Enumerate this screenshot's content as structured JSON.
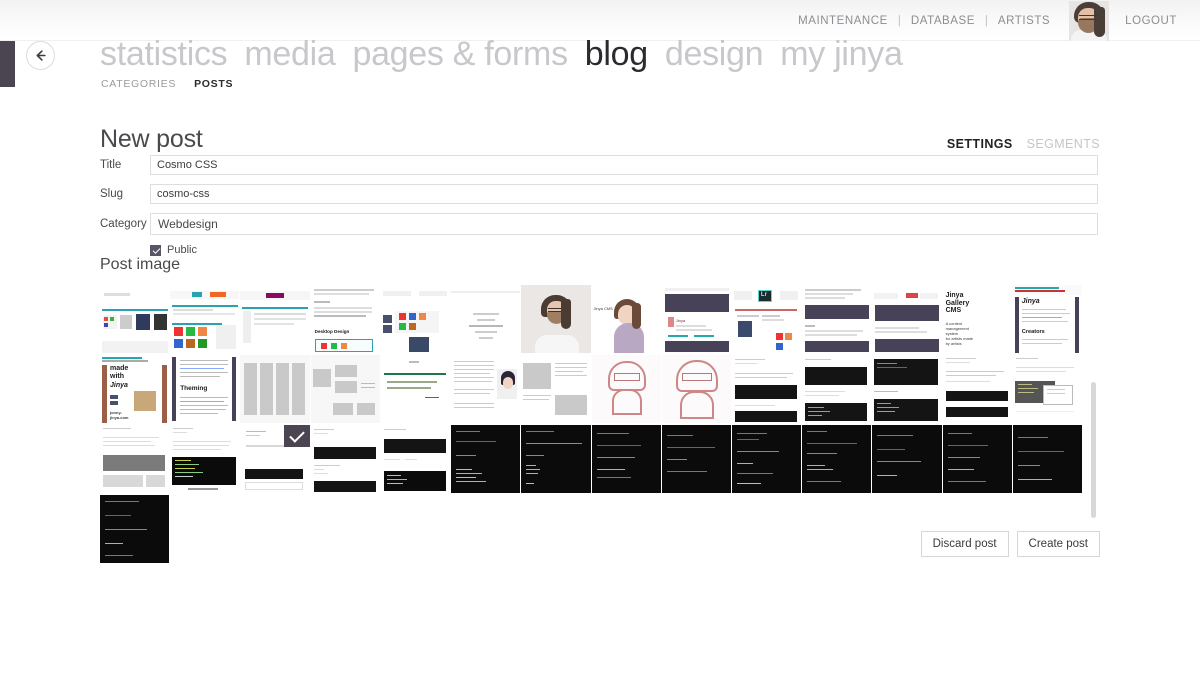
{
  "topbar": {
    "links": [
      {
        "label": "MAINTENANCE",
        "name": "maintenance"
      },
      {
        "label": "DATABASE",
        "name": "database"
      },
      {
        "label": "ARTISTS",
        "name": "artists"
      }
    ],
    "separator": "|",
    "logout_label": "LOGOUT",
    "avatar_name": "user-avatar"
  },
  "nav": {
    "back_icon": "arrow-left-icon",
    "items": [
      {
        "label": "statistics",
        "active": false
      },
      {
        "label": "media",
        "active": false
      },
      {
        "label": "pages & forms",
        "active": false
      },
      {
        "label": "blog",
        "active": true
      },
      {
        "label": "design",
        "active": false
      },
      {
        "label": "my jinya",
        "active": false
      }
    ],
    "sub_items": [
      {
        "label": "CATEGORIES",
        "active": false
      },
      {
        "label": "POSTS",
        "active": true
      }
    ]
  },
  "page": {
    "title": "New post"
  },
  "tabs": [
    {
      "label": "SETTINGS",
      "active": true
    },
    {
      "label": "SEGMENTS",
      "active": false
    }
  ],
  "form": {
    "title": {
      "label": "Title",
      "value": "Cosmo CSS",
      "placeholder": "Title"
    },
    "slug": {
      "label": "Slug",
      "value": "cosmo-css",
      "placeholder": "Slug"
    },
    "category": {
      "label": "Category",
      "value": "Webdesign",
      "arrow_icon": "chevron-down-icon"
    },
    "public": {
      "label": "Public",
      "checked": true
    }
  },
  "post_image": {
    "section_label": "Post image",
    "selected_index": 30,
    "selected_badge_icon": "check-icon",
    "columns": 14,
    "rows": 3,
    "thumbnails": [
      {
        "style": "icons-light",
        "label": ""
      },
      {
        "style": "web-teal",
        "label": ""
      },
      {
        "style": "web-magenta",
        "label": ""
      },
      {
        "style": "article-desktop",
        "label": "Desktop Design"
      },
      {
        "style": "icons-grid",
        "label": ""
      },
      {
        "style": "text-centered",
        "label": ""
      },
      {
        "style": "portrait-photo",
        "label": ""
      },
      {
        "style": "portrait-anime",
        "label": "Jinya CMS"
      },
      {
        "style": "web-dark-header",
        "label": ""
      },
      {
        "style": "adobe-lr",
        "label": "Lr"
      },
      {
        "style": "web-article",
        "label": ""
      },
      {
        "style": "web-dark-blocks",
        "label": ""
      },
      {
        "style": "jinya-cms",
        "label": "Jinya Gallery CMS"
      },
      {
        "style": "jinya-creators",
        "label": "Creators"
      },
      {
        "style": "made-with-jinya",
        "label": "made with Jinya"
      },
      {
        "style": "doc-theming",
        "label": "Theming"
      },
      {
        "style": "wireframe-cols",
        "label": ""
      },
      {
        "style": "wireframe-boxes",
        "label": ""
      },
      {
        "style": "doc-green",
        "label": ""
      },
      {
        "style": "doc-anime",
        "label": ""
      },
      {
        "style": "doc-boxes",
        "label": ""
      },
      {
        "style": "sketch-face",
        "label": ""
      },
      {
        "style": "sketch-face2",
        "label": ""
      },
      {
        "style": "doc-terminal",
        "label": ""
      },
      {
        "style": "web-dark-wide",
        "label": ""
      },
      {
        "style": "web-dark-list",
        "label": ""
      },
      {
        "style": "web-dark-panel",
        "label": ""
      },
      {
        "style": "web-menu-popup",
        "label": ""
      },
      {
        "style": "doc-code",
        "label": ""
      },
      {
        "style": "doc-white-form",
        "label": ""
      },
      {
        "style": "doc-selected",
        "label": ""
      },
      {
        "style": "doc-terminal2",
        "label": ""
      },
      {
        "style": "doc-terminal3",
        "label": ""
      },
      {
        "style": "term-black",
        "label": ""
      },
      {
        "style": "term-black2",
        "label": ""
      },
      {
        "style": "term-black3",
        "label": ""
      },
      {
        "style": "term-black4",
        "label": ""
      },
      {
        "style": "term-black5",
        "label": ""
      },
      {
        "style": "term-black6",
        "label": ""
      },
      {
        "style": "term-black7",
        "label": ""
      },
      {
        "style": "term-black8",
        "label": ""
      },
      {
        "style": "term-black9",
        "label": ""
      }
    ]
  },
  "actions": {
    "discard_label": "Discard post",
    "create_label": "Create post"
  },
  "colors": {
    "accent_purple": "#4a4551",
    "active_text": "#2b2b2f",
    "muted_text": "#c8c8cc"
  }
}
